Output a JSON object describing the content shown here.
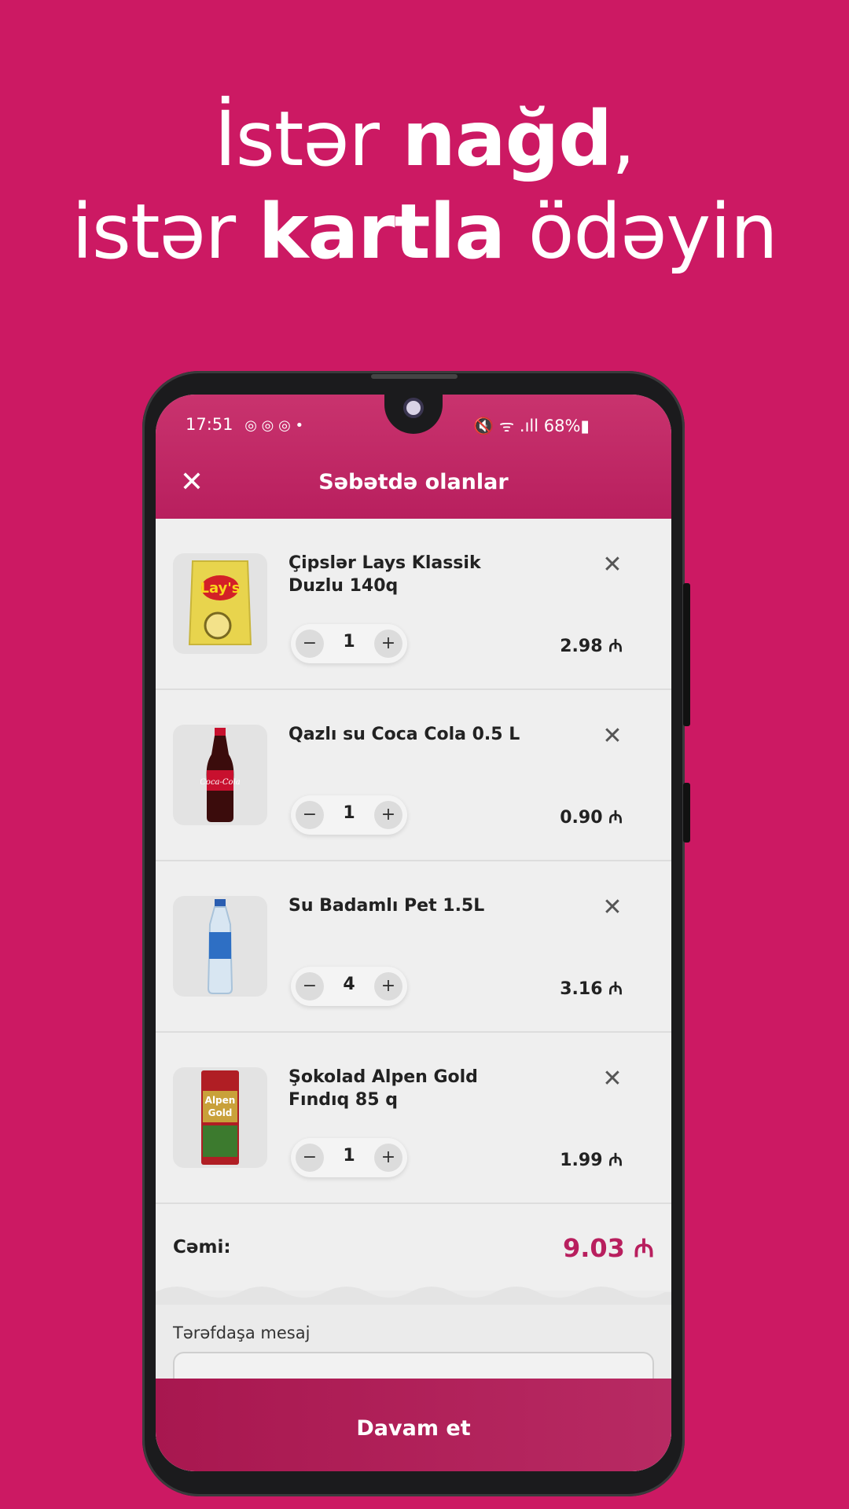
{
  "headline": {
    "line1_pre": "İstər ",
    "line1_bold": "nağd",
    "line1_post": ",",
    "line2_pre": "istər ",
    "line2_bold": "kartla",
    "line2_post": " ödəyin"
  },
  "status_bar": {
    "time": "17:51",
    "icons_left": "◎ ◎ ◎ •",
    "right": "🔇 ᯤ .ıll 68%▮",
    "battery": "68%"
  },
  "header": {
    "title": "Səbətdə olanlar",
    "close_icon": "✕"
  },
  "cart": {
    "items": [
      {
        "name": "Çipslər Lays Klassik Duzlu 140q",
        "qty": "1",
        "price": "2.98 ₼",
        "image": "lays-chips-icon"
      },
      {
        "name": "Qazlı su Coca Cola 0.5 L",
        "qty": "1",
        "price": "0.90 ₼",
        "image": "coca-cola-bottle-icon"
      },
      {
        "name": "Su Badamlı Pet 1.5L",
        "qty": "4",
        "price": "3.16 ₼",
        "image": "water-bottle-icon"
      },
      {
        "name": "Şokolad Alpen Gold Fındıq 85 q",
        "qty": "1",
        "price": "1.99 ₼",
        "image": "alpen-gold-chocolate-icon"
      }
    ],
    "minus": "−",
    "plus": "+",
    "remove": "✕"
  },
  "total": {
    "label": "Cəmi:",
    "value": "9.03 ₼"
  },
  "message": {
    "label": "Tərəfdaşa mesaj",
    "value": ""
  },
  "continue_button": "Davam et",
  "colors": {
    "background": "#CC1963",
    "accent": "#B81F5E"
  }
}
